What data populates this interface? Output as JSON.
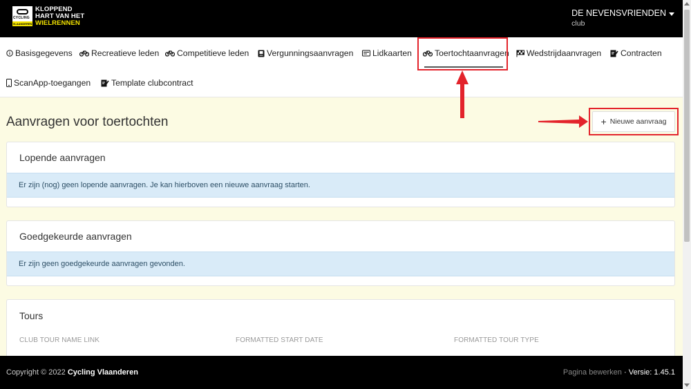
{
  "header": {
    "logo_badge_text": "CYCLING",
    "logo_badge_sub": "VLAANDEREN",
    "logo_line1": "KLOPPEND",
    "logo_line2": "HART VAN HET",
    "logo_line3": "WIELRENNEN",
    "user_name": "DE NEVENSVRIENDEN",
    "user_role": "club"
  },
  "nav": {
    "items": [
      {
        "label": "Basisgegevens",
        "icon": "info-circle-icon"
      },
      {
        "label": "Recreatieve leden",
        "icon": "bicycle-icon"
      },
      {
        "label": "Competitieve leden",
        "icon": "bicycle-icon"
      },
      {
        "label": "Vergunningsaanvragen",
        "icon": "id-badge-icon"
      },
      {
        "label": "Lidkaarten",
        "icon": "id-card-icon"
      },
      {
        "label": "Toertochtaanvragen",
        "icon": "bicycle-icon"
      },
      {
        "label": "Wedstrijdaanvragen",
        "icon": "checkered-flag-icon"
      },
      {
        "label": "Contracten",
        "icon": "signature-icon"
      },
      {
        "label": "ScanApp-toegangen",
        "icon": "mobile-icon"
      },
      {
        "label": "Template clubcontract",
        "icon": "signature-icon"
      }
    ],
    "active_index": 5
  },
  "main": {
    "title": "Aanvragen voor toertochten",
    "new_button_label": "Nieuwe aanvraag",
    "running": {
      "title": "Lopende aanvragen",
      "message": "Er zijn (nog) geen lopende aanvragen. Je kan hierboven een nieuwe aanvraag starten."
    },
    "approved": {
      "title": "Goedgekeurde aanvragen",
      "message": "Er zijn geen goedgekeurde aanvragen gevonden."
    },
    "tours": {
      "title": "Tours",
      "columns": [
        "CLUB TOUR NAME LINK",
        "FORMATTED START DATE",
        "FORMATTED TOUR TYPE"
      ]
    }
  },
  "footer": {
    "copyright_prefix": "Copyright © 2022",
    "copyright_org": "Cycling Vlaanderen",
    "edit_link": "Pagina bewerken",
    "separator": "·",
    "version": "Versie: 1.45.1"
  },
  "colors": {
    "highlight": "#e3232b",
    "brand_yellow": "#f4e400",
    "alert_bg": "#d9ebf8",
    "page_bg": "#fcfbe3"
  }
}
